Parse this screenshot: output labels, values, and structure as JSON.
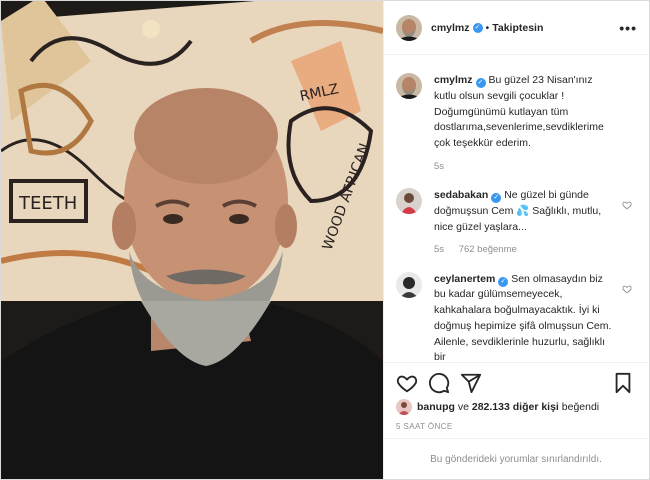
{
  "post": {
    "author": "cmylmz",
    "follow_separator": "•",
    "follow_status": "Takiptesin",
    "more_label": "•••"
  },
  "caption": {
    "username": "cmylmz",
    "text": "Bu güzel 23 Nisan'ınız kutlu olsun sevgili çocuklar ! Doğumgünümü kutlayan tüm dostlarıma,sevenlerime,sevdiklerime çok teşekkür ederim.",
    "time": "5s"
  },
  "comments": [
    {
      "username": "sedabakan",
      "text": "Ne güzel bi günde doğmuşsun Cem 💦 Sağlıklı, mutlu, nice güzel yaşlara...",
      "time": "5s",
      "likes": "762 beğenme"
    },
    {
      "username": "ceylanertem",
      "text": "Sen olmasaydın biz bu kadar gülümsemeyecek, kahkahalara boğulmayacaktık. İyi ki doğmuş hepimize şifâ olmuşsun Cem. Ailenle, sevdiklerinle huzurlu, sağlıklı bir"
    }
  ],
  "likes": {
    "liker": "banupg",
    "connector": "ve",
    "others": "282.133 diğer kişi",
    "suffix": "beğendi"
  },
  "timestamp": "5 SAAT ÖNCE",
  "comments_limited": "Bu gönderideki yorumlar sınırlandırıldı.",
  "colors": {
    "verified": "#3897f0",
    "muted": "#8e8e8e",
    "border": "#efefef"
  }
}
